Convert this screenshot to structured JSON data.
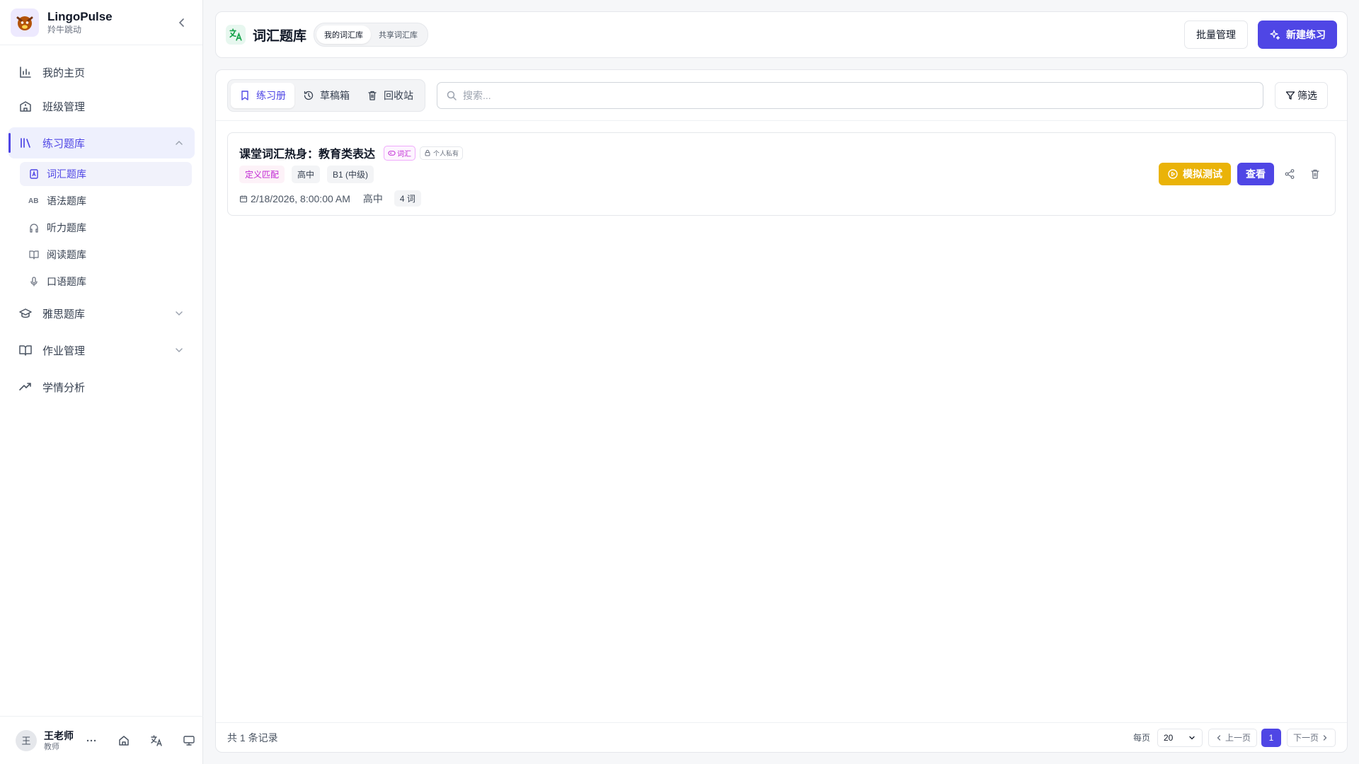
{
  "app": {
    "name": "LingoPulse",
    "subtitle": "羚牛跳动"
  },
  "sidebar": {
    "items": [
      {
        "label": "我的主页",
        "icon": "bar-chart-icon"
      },
      {
        "label": "班级管理",
        "icon": "school-icon"
      },
      {
        "label": "练习题库",
        "icon": "library-icon"
      },
      {
        "label": "雅思题库",
        "icon": "graduation-cap-icon"
      },
      {
        "label": "作业管理",
        "icon": "book-open-icon"
      },
      {
        "label": "学情分析",
        "icon": "trending-up-icon"
      }
    ],
    "subitems": [
      {
        "label": "词汇题库",
        "icon": "vocab-icon"
      },
      {
        "label": "语法题库",
        "icon": "ab-icon"
      },
      {
        "label": "听力题库",
        "icon": "headphones-icon"
      },
      {
        "label": "阅读题库",
        "icon": "book-icon"
      },
      {
        "label": "口语题库",
        "icon": "mic-icon"
      }
    ]
  },
  "user": {
    "avatar": "王",
    "name": "王老师",
    "role": "教师"
  },
  "header": {
    "title": "词汇题库",
    "segments": [
      "我的词汇库",
      "共享词汇库"
    ],
    "batch_label": "批量管理",
    "new_label": "新建练习"
  },
  "toolbar": {
    "tabs": [
      "练习册",
      "草稿箱",
      "回收站"
    ],
    "search_placeholder": "搜索...",
    "filter_label": "筛选"
  },
  "card": {
    "title": "课堂词汇热身：教育类表达",
    "type_tag": "词汇",
    "privacy_tag": "个人私有",
    "chips": [
      "定义匹配",
      "高中",
      "B1 (中级)"
    ],
    "date": "2/18/2026, 8:00:00 AM",
    "level": "高中",
    "count": "4 词",
    "mock_label": "模拟测试",
    "view_label": "查看"
  },
  "footer": {
    "total": "共 1 条记录",
    "per_page_label": "每页",
    "per_page": "20",
    "prev": "上一页",
    "page": "1",
    "next": "下一页"
  },
  "colors": {
    "accent": "#4f46e5",
    "warning": "#eab308",
    "pink": "#c026d3"
  }
}
